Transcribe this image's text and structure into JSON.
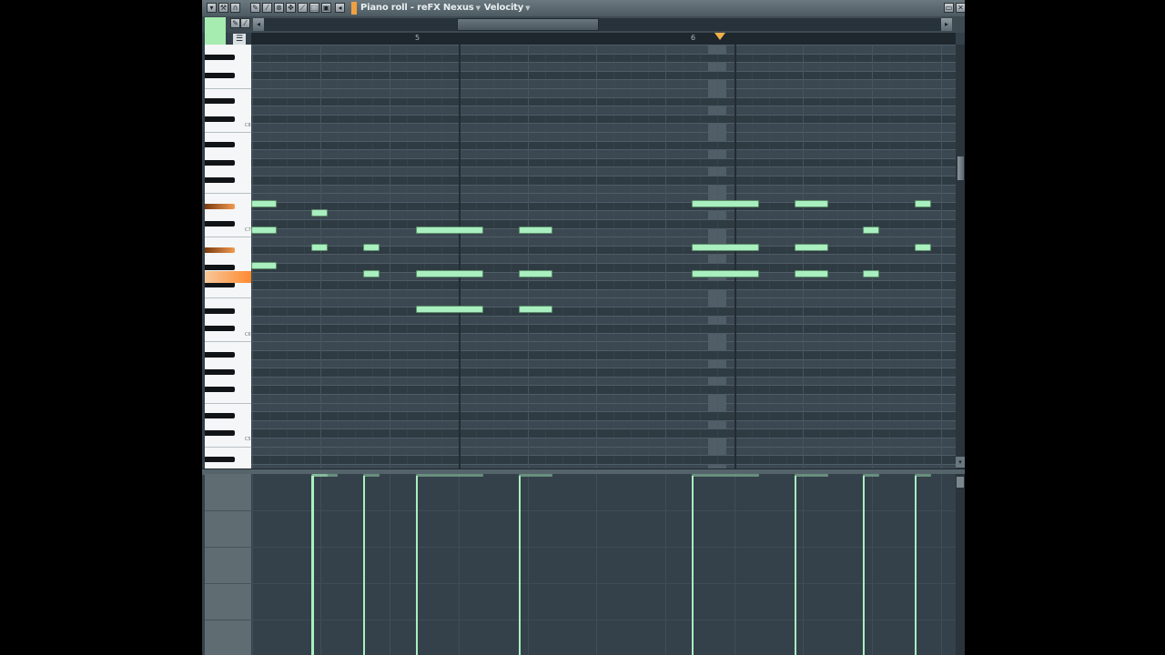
{
  "window": {
    "title": "Piano roll - reFX Nexus",
    "mode": "Velocity",
    "accent_color": "#f0a040",
    "note_color": "#a9efbf"
  },
  "toolbar": {
    "icons": [
      "dropdown-icon",
      "wrench-icon",
      "magnet-icon",
      "pencil-icon",
      "brush-icon",
      "delete-icon",
      "mute-icon",
      "slice-icon",
      "select-icon",
      "zoom-icon",
      "playback-icon"
    ],
    "right_icons": [
      "restore-icon",
      "close-icon"
    ]
  },
  "timeline": {
    "bar_5": "5",
    "bar_6": "6"
  },
  "keyboard": {
    "labels": [
      "C8",
      "C7",
      "C6",
      "C5"
    ]
  },
  "notes": [
    {
      "bar": "4.4",
      "pitch": "row11"
    }
  ]
}
